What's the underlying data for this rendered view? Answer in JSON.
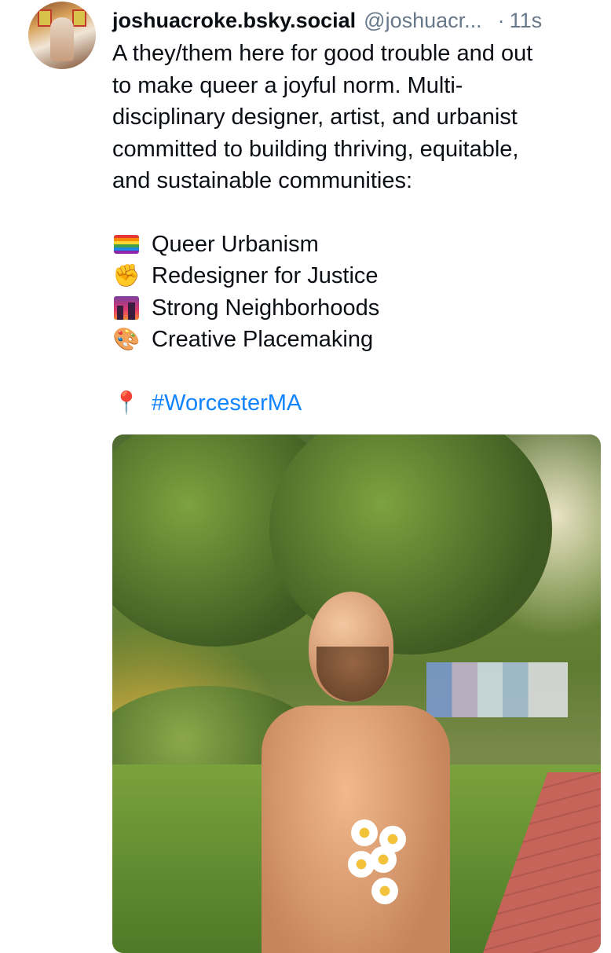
{
  "post": {
    "display_name": "joshuacroke.bsky.social",
    "handle": "@joshuacr...",
    "separator": "·",
    "time": "11s",
    "bio_lines": [
      "A they/them here for good trouble and out",
      "to make queer a joyful norm. Multi-",
      "disciplinary designer, artist, and urbanist",
      "committed to building thriving, equitable,",
      "and sustainable communities:"
    ],
    "list": [
      {
        "icon": "rainbow-flag-icon",
        "text": "Queer Urbanism"
      },
      {
        "icon": "raised-fist-icon",
        "text": "Redesigner for Justice"
      },
      {
        "icon": "cityscape-icon",
        "text": "Strong Neighborhoods"
      },
      {
        "icon": "artist-palette-icon",
        "text": "Creative Placemaking"
      }
    ],
    "location_icon": "round-pushpin-icon",
    "hashtag": "#WorcesterMA"
  },
  "colors": {
    "hashtag": "#1083fe",
    "muted": "#66788a",
    "text": "#0b0f14"
  }
}
